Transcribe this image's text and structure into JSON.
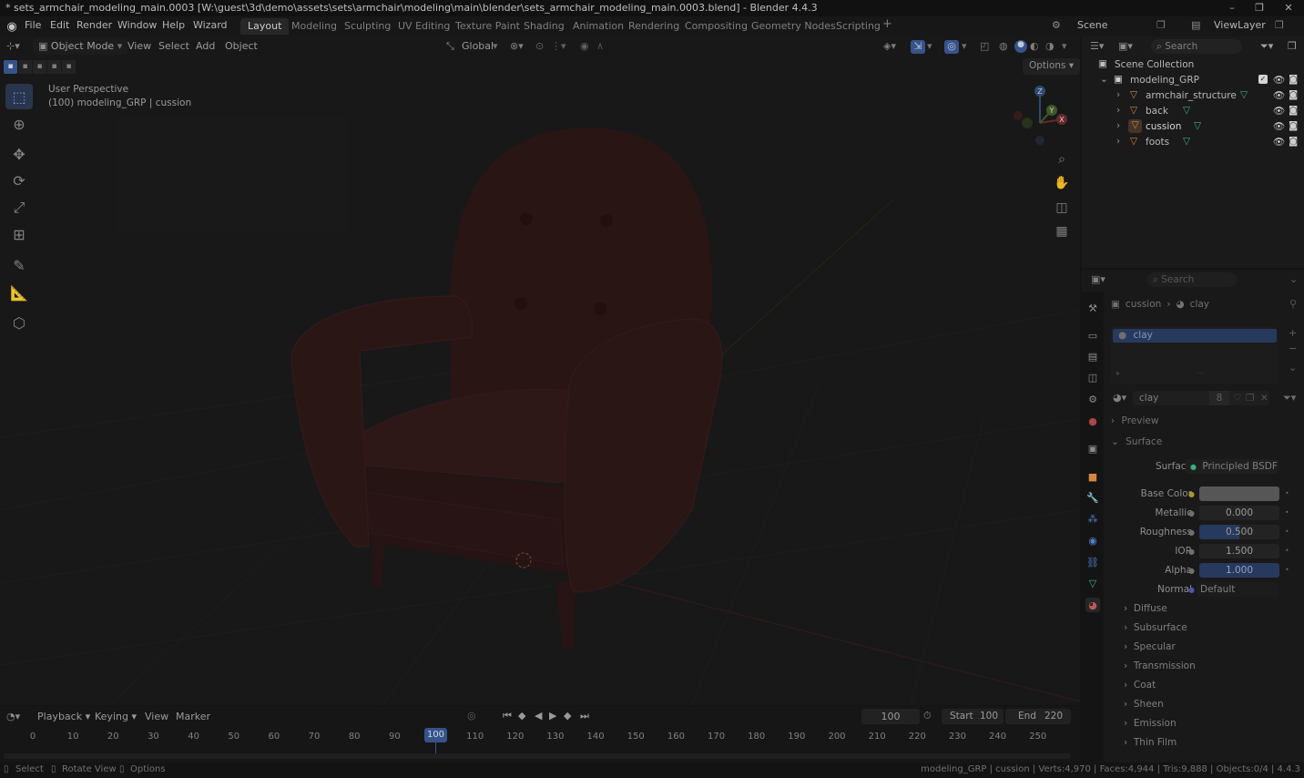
{
  "window": {
    "title": "* sets_armchair_modeling_main.0003 [W:\\guest\\3d\\demo\\assets\\sets\\armchair\\modeling\\main\\blender\\sets_armchair_modeling_main.0003.blend] - Blender 4.4.3"
  },
  "menu": {
    "file": "File",
    "edit": "Edit",
    "render": "Render",
    "window": "Window",
    "help": "Help",
    "wizard": "Wizard"
  },
  "workspaces": [
    "Layout",
    "Modeling",
    "Sculpting",
    "UV Editing",
    "Texture Paint",
    "Shading",
    "Animation",
    "Rendering",
    "Compositing",
    "Geometry Nodes",
    "Scripting"
  ],
  "scene": {
    "name": "Scene",
    "view_layer": "ViewLayer"
  },
  "viewport": {
    "mode": "Object Mode",
    "menu": {
      "view": "View",
      "select": "Select",
      "add": "Add",
      "object": "Object"
    },
    "transform_orientation": "Global",
    "options": "Options",
    "overlay_title": "User Perspective",
    "overlay_subtitle": "(100) modeling_GRP | cussion",
    "axis": {
      "z": "Z",
      "y": "Y",
      "x": "X"
    }
  },
  "outliner": {
    "search_placeholder": "Search",
    "root": "Scene Collection",
    "collection": "modeling_GRP",
    "objects": [
      "armchair_structure",
      "back",
      "cussion",
      "foots"
    ]
  },
  "properties": {
    "search_placeholder": "Search",
    "breadcrumb_object": "cussion",
    "breadcrumb_material": "clay",
    "slot_name": "clay",
    "material_name": "clay",
    "user_count": "8",
    "sections": {
      "preview": "Preview",
      "surface": "Surface"
    },
    "surface_label": "Surface",
    "surface_shader": "Principled BSDF",
    "fields": {
      "base_color_label": "Base Color",
      "metallic_label": "Metallic",
      "metallic": "0.000",
      "roughness_label": "Roughness",
      "roughness": "0.500",
      "ior_label": "IOR",
      "ior": "1.500",
      "alpha_label": "Alpha",
      "alpha": "1.000",
      "normal_label": "Normal",
      "normal": "Default"
    },
    "subpanels": [
      "Diffuse",
      "Subsurface",
      "Specular",
      "Transmission",
      "Coat",
      "Sheen",
      "Emission",
      "Thin Film"
    ]
  },
  "timeline": {
    "menu": {
      "playback": "Playback",
      "keying": "Keying",
      "view": "View",
      "marker": "Marker"
    },
    "current_frame": "100",
    "start_label": "Start",
    "start": "100",
    "end_label": "End",
    "end": "220",
    "ticks": [
      "0",
      "10",
      "20",
      "30",
      "40",
      "50",
      "60",
      "70",
      "80",
      "90",
      "100",
      "110",
      "120",
      "130",
      "140",
      "150",
      "160",
      "170",
      "180",
      "190",
      "200",
      "210",
      "220",
      "230",
      "240",
      "250"
    ]
  },
  "statusbar": {
    "select": "Select",
    "rotate_view": "Rotate View",
    "options": "Options",
    "stats": "modeling_GRP | cussion | Verts:4,970 | Faces:4,944 | Tris:9,888 | Objects:0/4 | 4.4.3"
  },
  "colors": {
    "accent": "#4772b3",
    "selection": "#26324a",
    "mesh_icon": "#3fbf8f",
    "object_icon": "#e8924a"
  }
}
